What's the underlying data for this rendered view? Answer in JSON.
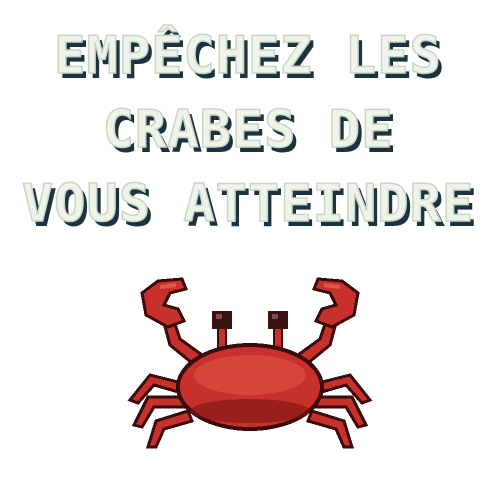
{
  "title": {
    "lines": [
      "EMPÊCHEZ LES",
      "CRABES DE",
      "VOUS ATTEINDRE"
    ]
  },
  "colors": {
    "title_fill": "#eef4ea",
    "title_shadow": "#1d3240",
    "title_outline": "#c9d6c6",
    "crab_body": "#c8302b",
    "crab_light": "#e0584a",
    "crab_dark": "#7a1414",
    "crab_outline": "#3b0a0a",
    "crab_eye": "#3a1212",
    "background": "#ffffff"
  },
  "icons": {
    "mascot": "crab-icon"
  }
}
